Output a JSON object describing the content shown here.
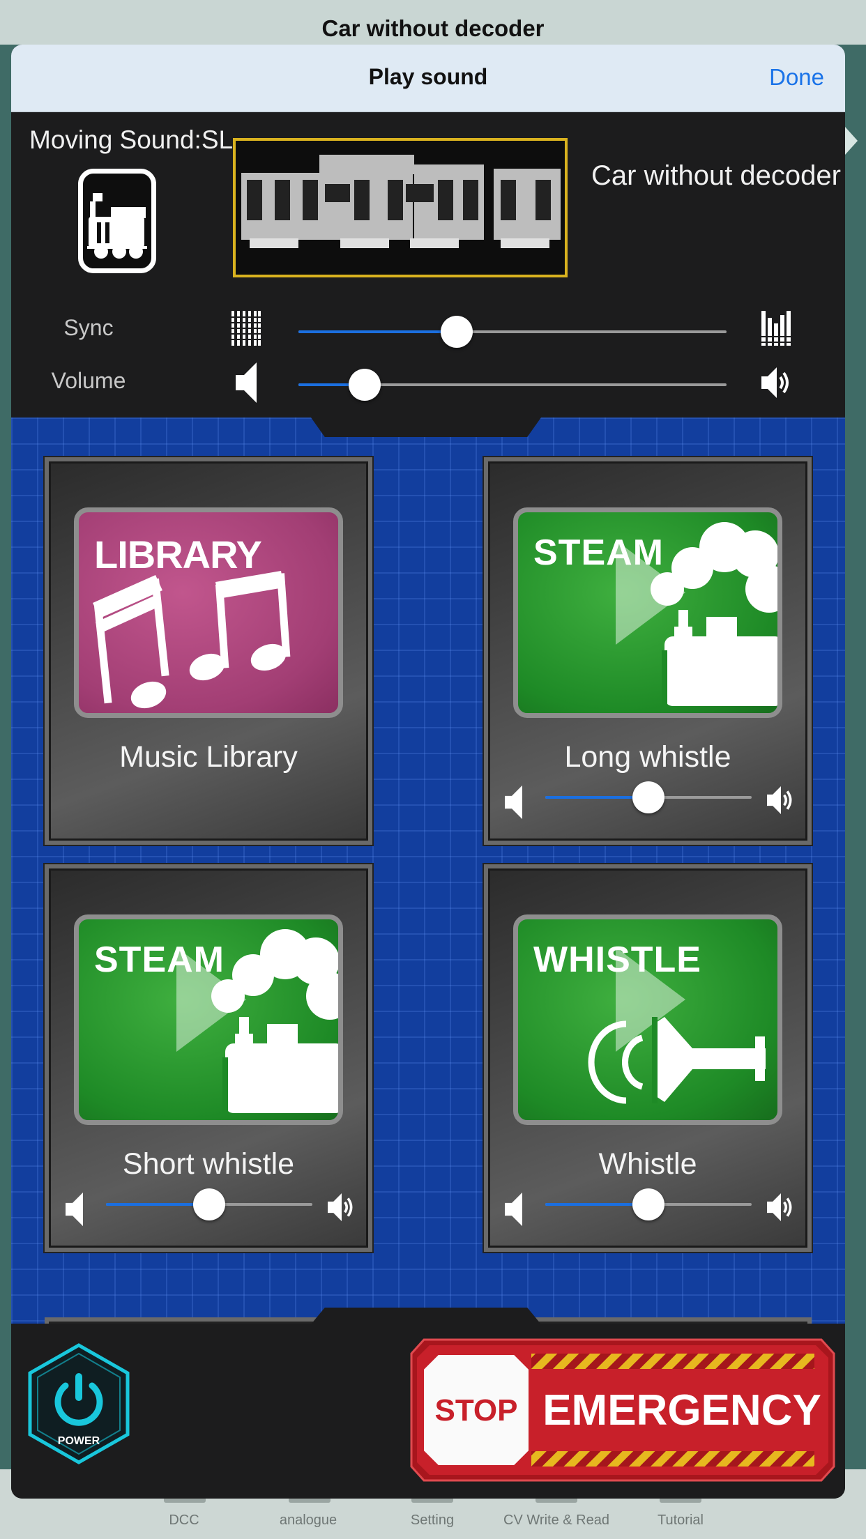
{
  "background": {
    "title": "Car without decoder",
    "tabs": [
      "DCC",
      "analogue",
      "Setting",
      "CV Write & Read",
      "Tutorial"
    ]
  },
  "navbar": {
    "title": "Play sound",
    "done_label": "Done"
  },
  "header": {
    "moving_sound_label": "Moving Sound:SL",
    "car_label": "Car without decoder"
  },
  "sliders": {
    "sync": {
      "label": "Sync",
      "value": 0.37
    },
    "volume": {
      "label": "Volume",
      "value": 0.155
    }
  },
  "sounds": [
    {
      "tile_word": "LIBRARY",
      "label": "Music Library",
      "color": "pink",
      "has_slider": false
    },
    {
      "tile_word": "STEAM",
      "label": "Long whistle",
      "color": "green",
      "has_slider": true,
      "volume": 0.5
    },
    {
      "tile_word": "STEAM",
      "label": "Short whistle",
      "color": "green",
      "has_slider": true,
      "volume": 0.5
    },
    {
      "tile_word": "WHISTLE",
      "label": "Whistle",
      "color": "green",
      "has_slider": true,
      "volume": 0.5
    }
  ],
  "controls": {
    "power_label": "POWER",
    "stop_label": "STOP",
    "emergency_label": "EMERGENCY"
  },
  "colors": {
    "accent": "#1b6fe0",
    "done": "#1a73e8",
    "power": "#19c7dc",
    "emergency": "#c8202a",
    "library": "#a23e74",
    "steam": "#1e8a26"
  }
}
